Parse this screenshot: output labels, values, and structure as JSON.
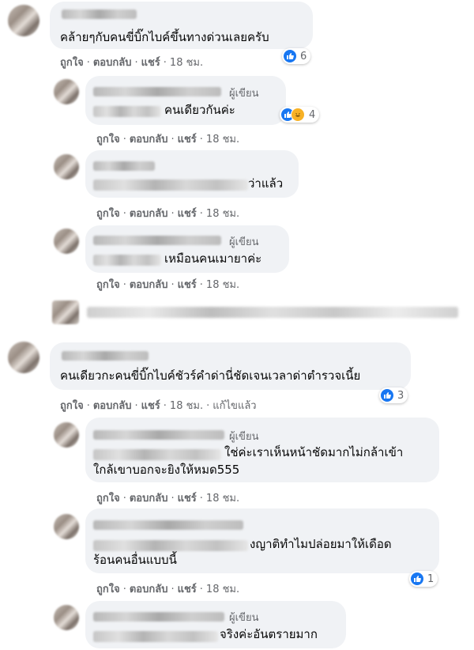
{
  "actions": {
    "like": "ถูกใจ",
    "reply": "ตอบกลับ",
    "share": "แชร์",
    "edited": "แก้ไขแล้ว",
    "dot": "·"
  },
  "author_tag": "ผู้เขียน",
  "comments": [
    {
      "text": "คล้ายๆกับคนขี่บิ๊กไบค์ขึ้นทางด่วนเลยครับ",
      "time": "18 ชม.",
      "reactions": "6"
    },
    {
      "text": "คนเดียวกันค่ะ",
      "time": "18 ชม.",
      "reactions": "4"
    },
    {
      "text": "ว่าแล้ว",
      "time": "18 ชม."
    },
    {
      "text": "เหมือนคนเมายาค่ะ",
      "time": "18 ชม."
    },
    {
      "text": "คนเดียวกะคนขี่บิ๊กไบค์ชัวร์คำด่านี่ชัดเจนเวลาด่าตำรวจเนี้ย",
      "time": "18 ชม.",
      "reactions": "3"
    },
    {
      "text_line1": "ใช่ค่ะเราเห็นหน้าชัดมากไม่กล้าเข้า",
      "text_line2": "ใกล้เขาบอกจะยิงให้หมด555",
      "time": "18 ชม."
    },
    {
      "text_line1": "งญาติทำไมปล่อยมาให้เดือด",
      "text_line2": "ร้อนคนอื่นแบบนี้",
      "time": "18 ชม.",
      "reactions": "1"
    },
    {
      "text": "จริงค่ะอันตรายมาก"
    }
  ],
  "colors": {
    "like_blue": "#1877f2",
    "haha_yellow": "#f7b125",
    "bubble": "#f0f2f5",
    "meta_gray": "#65676b"
  }
}
